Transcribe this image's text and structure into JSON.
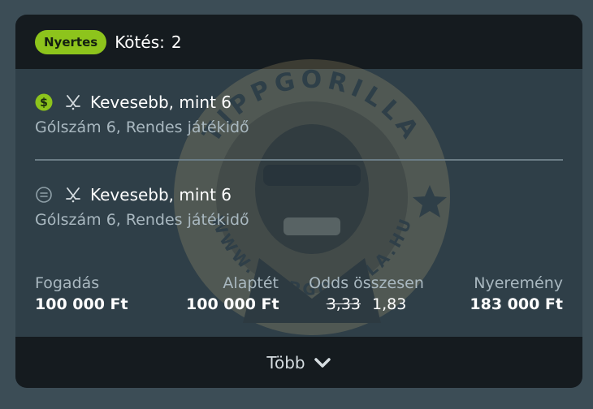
{
  "header": {
    "status": "Nyertes",
    "bet_label": "Kötés:",
    "bet_count": "2"
  },
  "watermark": {
    "text_top": "TIPPGORILLA",
    "text_bottom": "WWW.TIPPGORILLA.HU"
  },
  "selections": [
    {
      "status_icon": "dollar-coin-icon",
      "sport_icon": "hockey-sticks-icon",
      "name": "Kevesebb, mint 6",
      "market": "Gólszám 6, Rendes játékidő"
    },
    {
      "status_icon": "pending-icon",
      "sport_icon": "hockey-sticks-icon",
      "name": "Kevesebb, mint 6",
      "market": "Gólszám 6, Rendes játékidő"
    }
  ],
  "summary": {
    "stake_label": "Fogadás",
    "stake_value": "100 000 Ft",
    "base_label": "Alaptét",
    "base_value": "100 000 Ft",
    "odds_label": "Odds összesen",
    "odds_old": "3,33",
    "odds_new": "1,83",
    "win_label": "Nyeremény",
    "win_value": "183 000 Ft"
  },
  "footer": {
    "more_label": "Több"
  },
  "colors": {
    "win_badge": "#8dc41c",
    "header_bg": "#151b1f",
    "card_bg": "#2f3f48"
  }
}
